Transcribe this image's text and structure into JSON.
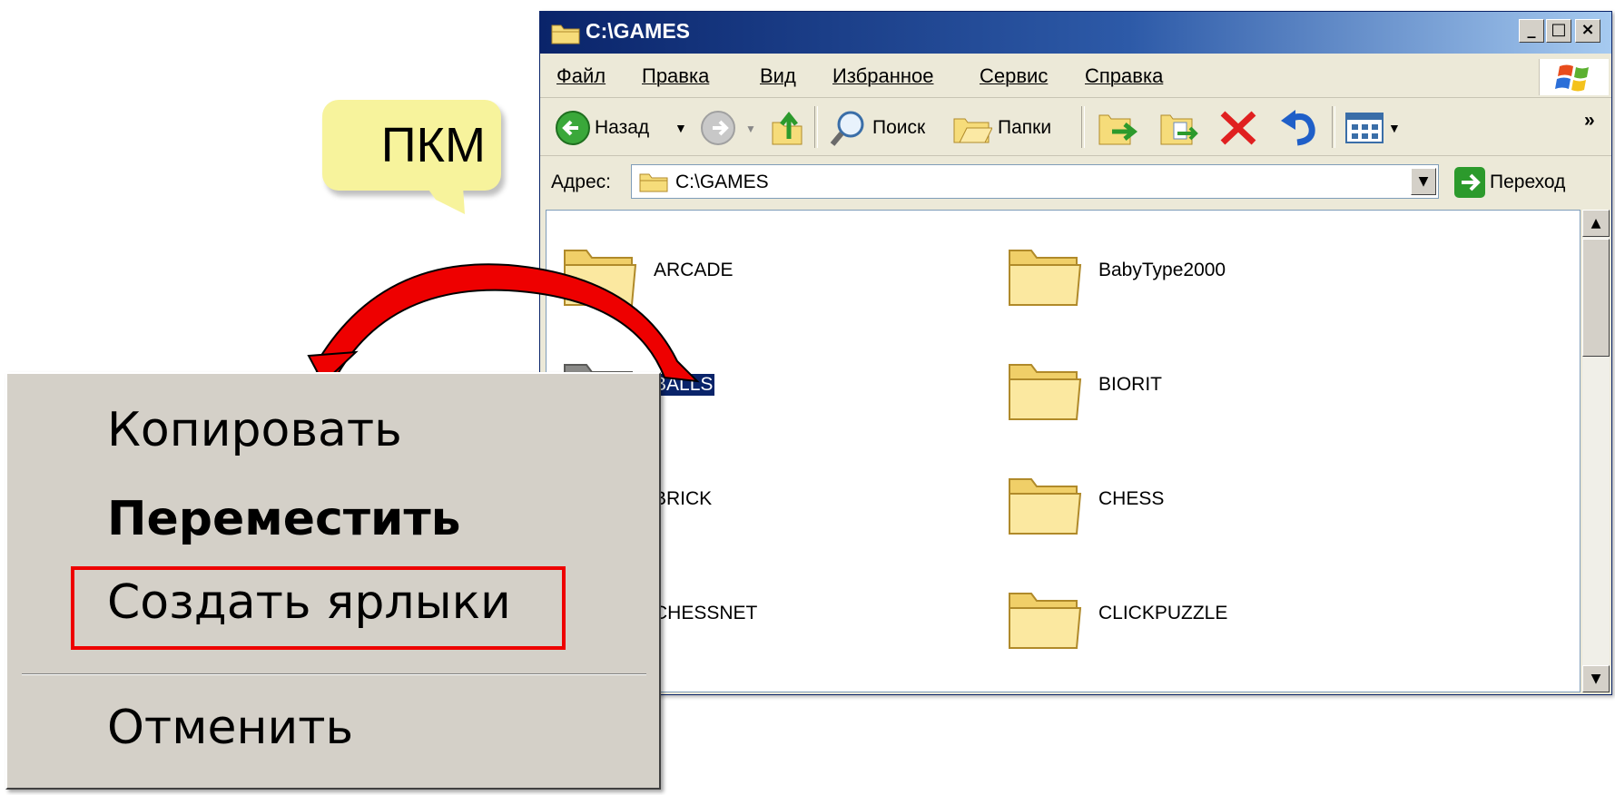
{
  "callout": {
    "text": "ПКМ"
  },
  "window": {
    "title": "C:\\GAMES",
    "controls": {
      "minimize": "_",
      "maximize": "□",
      "close": "×"
    }
  },
  "menubar": {
    "items": [
      "Файл",
      "Правка",
      "Вид",
      "Избранное",
      "Сервис",
      "Справка"
    ]
  },
  "toolbar": {
    "back_label": "Назад",
    "search_label": "Поиск",
    "folders_label": "Папки",
    "more": "»"
  },
  "address": {
    "label": "Адрес:",
    "value": "C:\\GAMES",
    "go_label": "Переход"
  },
  "files": [
    {
      "name": "ARCADE"
    },
    {
      "name": "BabyType2000"
    },
    {
      "name": "BALLS",
      "selected": true
    },
    {
      "name": "BIORIT"
    },
    {
      "name": "BRICK"
    },
    {
      "name": "CHESS"
    },
    {
      "name": "CHESSNET"
    },
    {
      "name": "CLICKPUZZLE"
    }
  ],
  "context_menu": {
    "items": [
      {
        "label": "Копировать"
      },
      {
        "label": "Переместить",
        "bold": true
      },
      {
        "label": "Создать ярлыки",
        "highlighted": true
      },
      {
        "label": "Отменить"
      }
    ]
  },
  "colors": {
    "title_blue": "#0a246a",
    "callout_yellow": "#f7f39c",
    "highlight_red": "#ee0000",
    "arrow_red": "#ee0000",
    "folder_yellow": "#f6dc7a"
  },
  "icons": [
    "folder-icon",
    "back-icon",
    "forward-icon",
    "up-icon",
    "search-icon",
    "folders-icon",
    "move-to-icon",
    "copy-to-icon",
    "delete-icon",
    "undo-icon",
    "views-icon",
    "go-icon",
    "windows-logo-icon"
  ]
}
